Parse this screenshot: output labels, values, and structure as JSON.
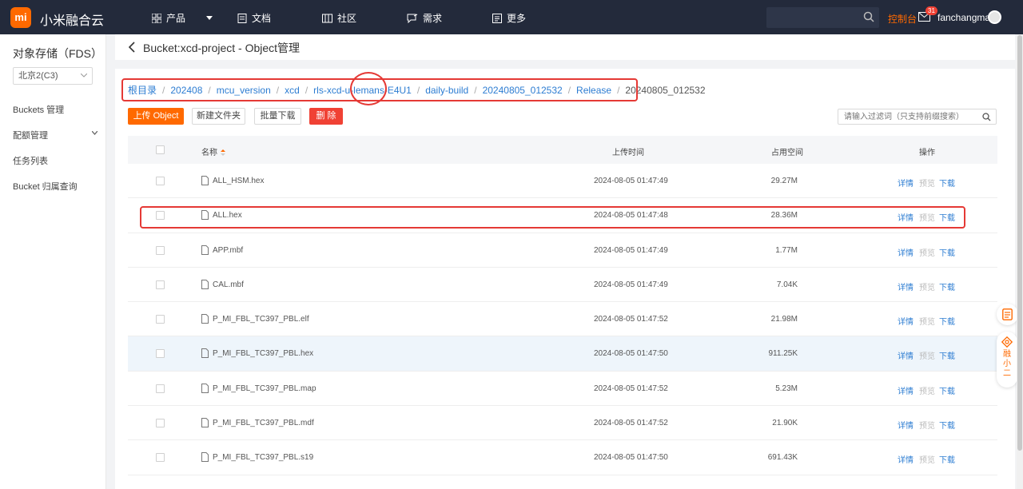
{
  "topbar": {
    "logo_text": "mi",
    "brand": "小米融合云",
    "nav": [
      {
        "label": "产品",
        "icon": "grid-icon"
      },
      {
        "label": "文档",
        "icon": "document-icon"
      },
      {
        "label": "社区",
        "icon": "building-icon"
      },
      {
        "label": "需求",
        "icon": "feedback-icon"
      },
      {
        "label": "更多",
        "icon": "more-icon"
      }
    ],
    "search_placeholder": "",
    "console": "控制台",
    "mail_badge": "31",
    "username": "fanchangmai"
  },
  "sidebar": {
    "title": "对象存储（FDS）",
    "region": "北京2(C3)",
    "items": [
      {
        "label": "Buckets 管理"
      },
      {
        "label": "配额管理"
      },
      {
        "label": "任务列表"
      },
      {
        "label": "Bucket 归属查询"
      }
    ]
  },
  "page": {
    "title": "Bucket:xcd-project - Object管理"
  },
  "breadcrumb": [
    "根目录",
    "202408",
    "mcu_version",
    "xcd",
    "rls-xcd-u-lemans-E4U1",
    "daily-build",
    "20240805_012532",
    "Release",
    "20240805_012532"
  ],
  "toolbar": {
    "upload": "上传 Object",
    "new_folder": "新建文件夹",
    "batch_download": "批量下载",
    "delete": "删 除",
    "filter_placeholder": "请输入过滤词（只支持前缀搜索）"
  },
  "table": {
    "columns": {
      "name": "名称",
      "time": "上传时间",
      "size": "占用空间",
      "actions": "操作"
    },
    "action_labels": {
      "detail": "详情",
      "preview": "预览",
      "download": "下载"
    },
    "rows": [
      {
        "name": "ALL_HSM.hex",
        "time": "2024-08-05 01:47:49",
        "size": "29.27M"
      },
      {
        "name": "ALL.hex",
        "time": "2024-08-05 01:47:48",
        "size": "28.36M"
      },
      {
        "name": "APP.mbf",
        "time": "2024-08-05 01:47:49",
        "size": "1.77M"
      },
      {
        "name": "CAL.mbf",
        "time": "2024-08-05 01:47:49",
        "size": "7.04K"
      },
      {
        "name": "P_MI_FBL_TC397_PBL.elf",
        "time": "2024-08-05 01:47:52",
        "size": "21.98M"
      },
      {
        "name": "P_MI_FBL_TC397_PBL.hex",
        "time": "2024-08-05 01:47:50",
        "size": "911.25K"
      },
      {
        "name": "P_MI_FBL_TC397_PBL.map",
        "time": "2024-08-05 01:47:52",
        "size": "5.23M"
      },
      {
        "name": "P_MI_FBL_TC397_PBL.mdf",
        "time": "2024-08-05 01:47:52",
        "size": "21.90K"
      },
      {
        "name": "P_MI_FBL_TC397_PBL.s19",
        "time": "2024-08-05 01:47:50",
        "size": "691.43K"
      }
    ]
  },
  "float": {
    "assistant": "融小二"
  },
  "colors": {
    "accent": "#ff6900",
    "link": "#2d7dd2",
    "danger": "#f04134",
    "annotation": "#e53935",
    "topbar": "#232a3b"
  }
}
